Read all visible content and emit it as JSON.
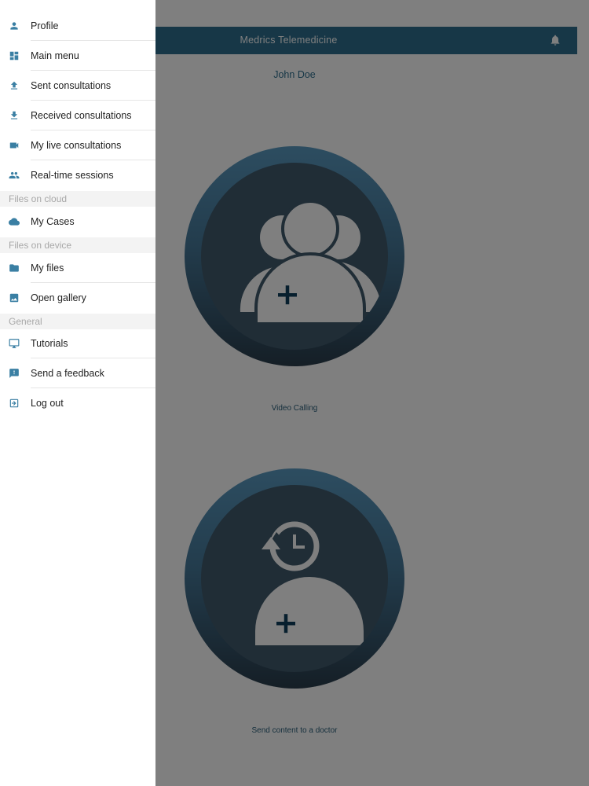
{
  "header": {
    "title": "Medrics Telemedicine",
    "bell_icon": "bell-icon"
  },
  "main": {
    "user_name": "John Doe",
    "video_calling": {
      "label": "Video Calling",
      "icon": "group-add-user-icon"
    },
    "send_content": {
      "label": "Send content to a doctor",
      "icon": "history-add-user-icon"
    }
  },
  "drawer": {
    "items": [
      {
        "label": "Profile",
        "icon": "person-icon"
      },
      {
        "label": "Main menu",
        "icon": "dashboard-icon"
      },
      {
        "label": "Sent consultations",
        "icon": "upload-icon"
      },
      {
        "label": "Received consultations",
        "icon": "download-icon"
      },
      {
        "label": "My live consultations",
        "icon": "videocam-icon"
      },
      {
        "label": "Real-time sessions",
        "icon": "people-icon"
      }
    ],
    "sections": {
      "cloud": {
        "title": "Files on cloud",
        "items": [
          {
            "label": "My Cases",
            "icon": "cloud-icon"
          }
        ]
      },
      "device": {
        "title": "Files on device",
        "items": [
          {
            "label": "My files",
            "icon": "folder-icon"
          },
          {
            "label": "Open gallery",
            "icon": "image-icon"
          }
        ]
      },
      "general": {
        "title": "General",
        "items": [
          {
            "label": "Tutorials",
            "icon": "monitor-icon"
          },
          {
            "label": "Send a feedback",
            "icon": "feedback-icon"
          },
          {
            "label": "Log out",
            "icon": "logout-icon"
          }
        ]
      }
    }
  },
  "colors": {
    "accent": "#2f6f8e",
    "icon": "#3a7fa3",
    "overlay": "#808080"
  }
}
